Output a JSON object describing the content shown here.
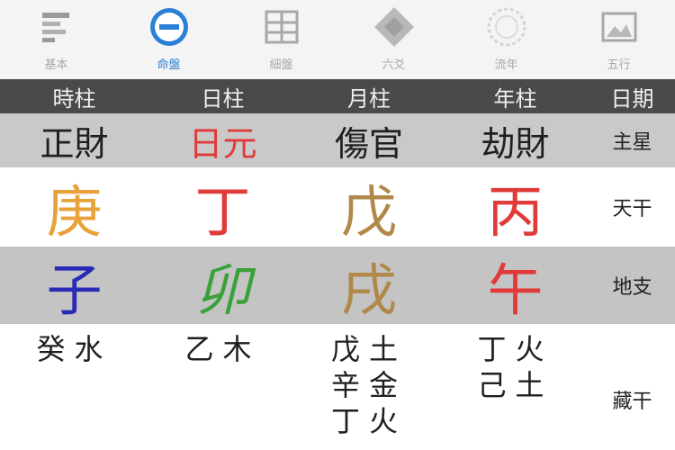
{
  "tabs": [
    {
      "label": "基本",
      "icon": "chart-icon",
      "active": false
    },
    {
      "label": "命盤",
      "icon": "minus-circle-icon",
      "active": true
    },
    {
      "label": "細盤",
      "icon": "grid-icon",
      "active": false
    },
    {
      "label": "六爻",
      "icon": "diamond-icon",
      "active": false
    },
    {
      "label": "流年",
      "icon": "sun-icon",
      "active": false
    },
    {
      "label": "五行",
      "icon": "image-icon",
      "active": false
    }
  ],
  "header": [
    "時柱",
    "日柱",
    "月柱",
    "年柱",
    "日期"
  ],
  "main_star": {
    "values": [
      "正財",
      "日元",
      "傷官",
      "劫財"
    ],
    "label": "主星"
  },
  "heavenly_stem": {
    "values": [
      "庚",
      "丁",
      "戊",
      "丙"
    ],
    "label": "天干"
  },
  "earthly_branch": {
    "values": [
      "子",
      "卯",
      "戌",
      "午"
    ],
    "label": "地支"
  },
  "hidden_stems": {
    "values": [
      [
        "癸水"
      ],
      [
        "乙木"
      ],
      [
        "戊土",
        "辛金",
        "丁火"
      ],
      [
        "丁火",
        "己土"
      ]
    ],
    "label": "藏干"
  },
  "colors": {
    "accent": "#2a7fd6",
    "header_bg": "#4a4a4a",
    "day_master": "#e03a3a",
    "metal": "#e8a23a",
    "fire": "#e03a3a",
    "earth": "#b0884a",
    "water": "#2a2ab8",
    "wood": "#3aa03a"
  }
}
